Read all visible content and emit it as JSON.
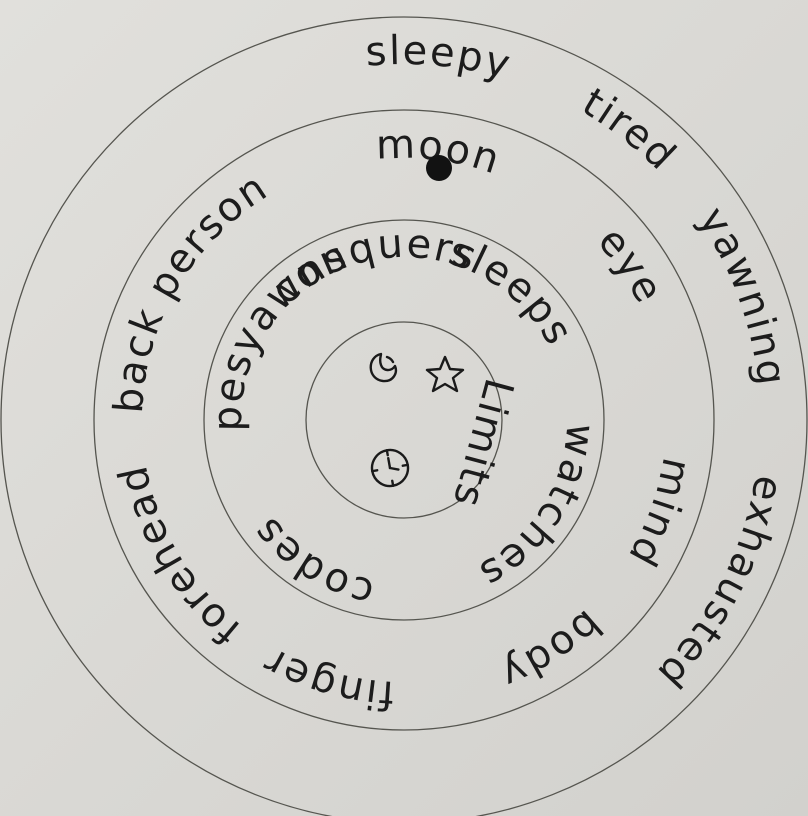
{
  "rings": {
    "outer": [
      "sleepy",
      "tired",
      "yawning",
      "exhausted"
    ],
    "second": [
      "moon",
      "eye",
      "mind",
      "body",
      "finger",
      "forehead",
      "back",
      "person"
    ],
    "third": [
      "sleeps",
      "watches",
      "codes",
      "hopes",
      "yawns",
      "conquers"
    ],
    "center": {
      "word": "Limits",
      "symbols": [
        "moon-icon",
        "star-icon",
        "clock-icon"
      ]
    }
  },
  "colors": {
    "paper": "#dcdbd7",
    "ink": "#1c1c1c",
    "line": "#55554f"
  }
}
